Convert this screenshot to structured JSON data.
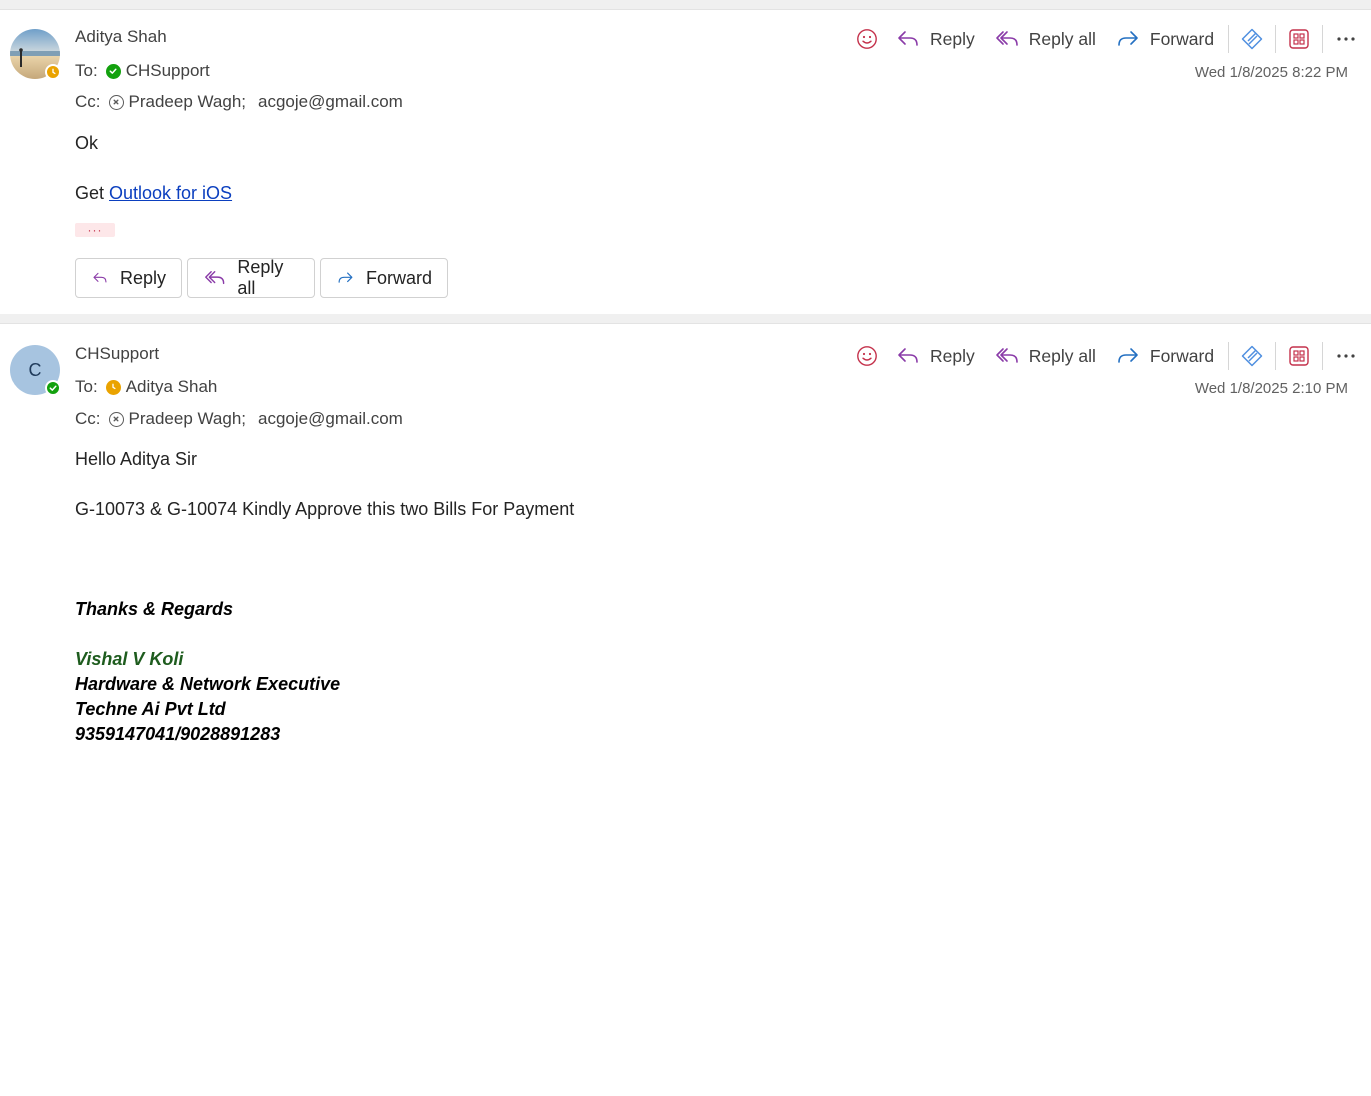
{
  "colors": {
    "accent_purple": "#8a3ba8",
    "forward_blue": "#2470c2",
    "link_blue": "#0b3fbf",
    "presence_available": "#13a10e",
    "presence_away": "#eaa300",
    "signature_green": "#1e5c1e"
  },
  "toolbar": {
    "reply": "Reply",
    "reply_all": "Reply all",
    "forward": "Forward",
    "icons": [
      "emoji-icon",
      "reply-icon",
      "reply-all-icon",
      "forward-icon",
      "loop-icon",
      "apps-icon",
      "more-icon"
    ]
  },
  "labels": {
    "to": "To:",
    "cc": "Cc:",
    "semicolon": ";"
  },
  "messages": [
    {
      "sender": "Aditya Shah",
      "sender_presence": "away",
      "to": {
        "name": "CHSupport",
        "presence": "available"
      },
      "cc": [
        {
          "name": "Pradeep Wagh",
          "presence": "offline"
        },
        {
          "name": "acgoje@gmail.com"
        }
      ],
      "date": "Wed 1/8/2025 8:22 PM",
      "body_line1": "Ok",
      "body_line2_prefix": "Get ",
      "body_link": "Outlook for iOS",
      "more_indicator": "···",
      "actions": {
        "reply": "Reply",
        "reply_all": "Reply all",
        "forward": "Forward"
      }
    },
    {
      "sender": "CHSupport",
      "avatar_initial": "C",
      "sender_presence": "available",
      "to": {
        "name": "Aditya Shah",
        "presence": "away"
      },
      "cc": [
        {
          "name": "Pradeep Wagh",
          "presence": "offline"
        },
        {
          "name": "acgoje@gmail.com"
        }
      ],
      "date": "Wed 1/8/2025 2:10 PM",
      "greeting": "Hello Aditya Sir",
      "body": "G-10073 & G-10074 Kindly Approve this two Bills For Payment",
      "signature": {
        "closing": "Thanks & Regards",
        "name": "Vishal V Koli",
        "title": "Hardware & Network Executive",
        "company": "Techne Ai Pvt Ltd",
        "phone": "9359147041/9028891283"
      }
    }
  ]
}
